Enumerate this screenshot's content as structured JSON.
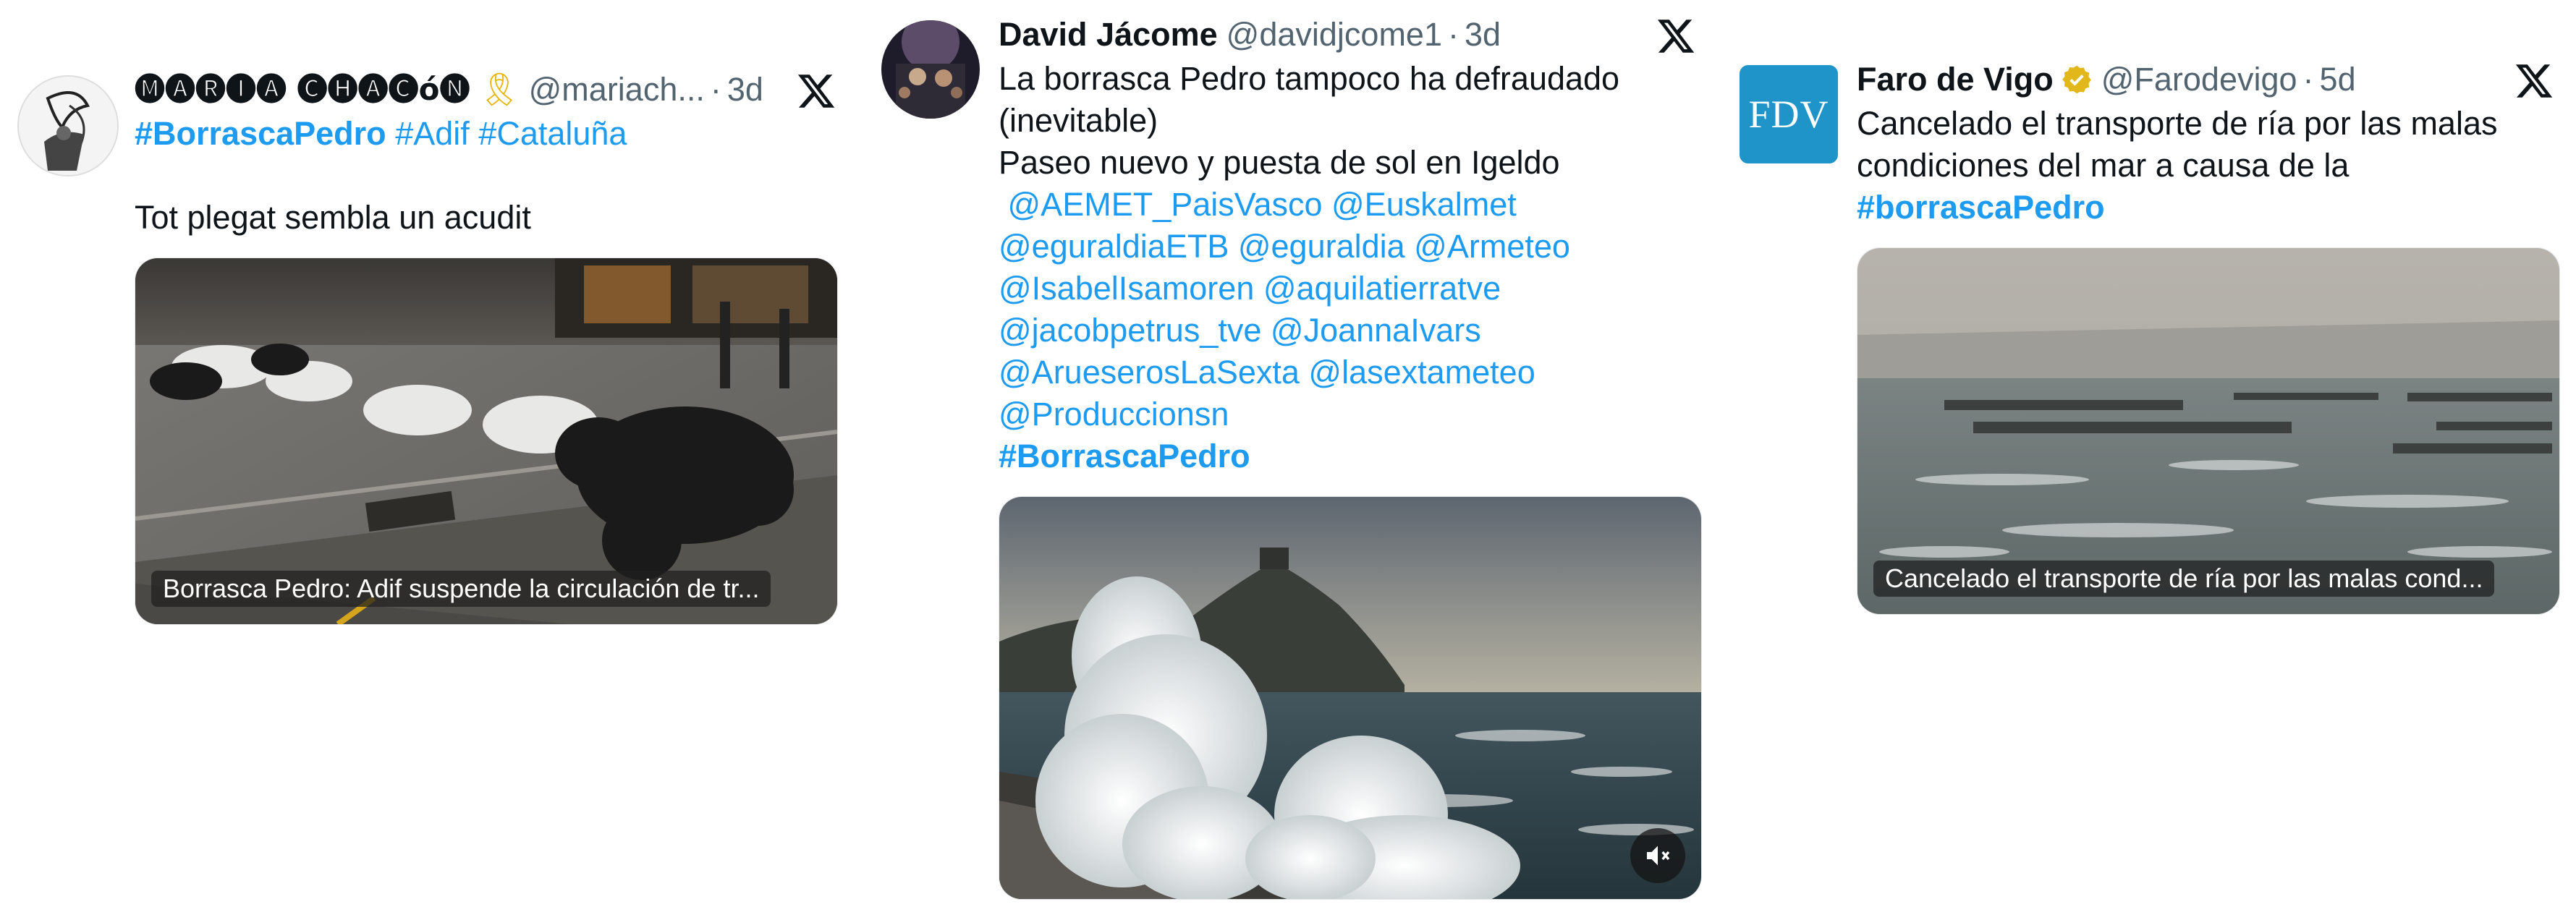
{
  "tweets": [
    {
      "author_name": "🅜🅐🅡🅘🅐 🅒🅗🅐🅒ó🅝",
      "ribbon": "🎗",
      "handle": "@mariach...",
      "separator": "·",
      "time": "3d",
      "hashtags": [
        "#BorrascaPedro",
        "#Adif",
        "#Cataluña"
      ],
      "text": "Tot plegat sembla un acudit",
      "media_caption": "Borrasca Pedro: Adif suspende la circulación de tr..."
    },
    {
      "author_name": "David Jácome",
      "handle": "@davidjcome1",
      "separator": "·",
      "time": "3d",
      "text_lines": [
        "La borrasca Pedro tampoco ha defraudado",
        "(inevitable)",
        "Paseo nuevo y puesta de sol en Igeldo"
      ],
      "mention_lines": [
        " @AEMET_PaisVasco @Euskalmet",
        "@eguraldiaETB @eguraldia @Armeteo",
        "@IsabelIsamoren @aquilatierratve",
        "@jacobpetrus_tve @JoannaIvars",
        "@ArueserosLaSexta @lasextameteo",
        "@Produccionsn"
      ],
      "hashtag": "#BorrascaPedro",
      "video_control": "mute-icon"
    },
    {
      "author_name": "Faro de Vigo",
      "handle": "@Farodevigo",
      "separator": "·",
      "time": "5d",
      "logo_text": "FDV",
      "text_lines": [
        "Cancelado el transporte de ría por las malas",
        "condiciones del mar a causa de la"
      ],
      "hashtag": "#borrascaPedro",
      "media_caption": "Cancelado el transporte de ría por las malas cond..."
    }
  ],
  "colors": {
    "link": "#1d9bf0",
    "secondary": "#536471",
    "verified": "#e2b719",
    "fdv_logo": "#1e94c8"
  }
}
